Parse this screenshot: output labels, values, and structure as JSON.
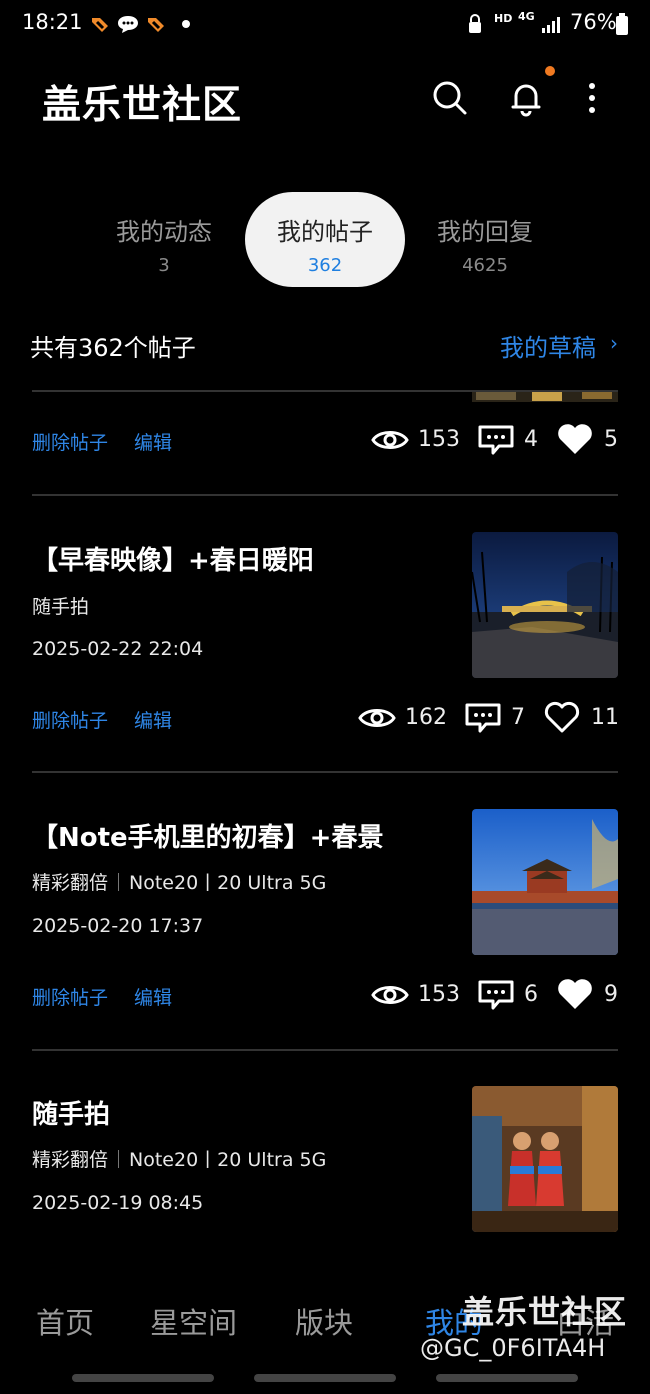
{
  "status_bar": {
    "time": "18:21",
    "hd": "HD",
    "net": "4G",
    "battery": "76%"
  },
  "header": {
    "title": "盖乐世社区"
  },
  "tabs": [
    {
      "label": "我的动态",
      "count": "3"
    },
    {
      "label": "我的帖子",
      "count": "362"
    },
    {
      "label": "我的回复",
      "count": "4625"
    }
  ],
  "summary": {
    "count_text": "共有362个帖子",
    "drafts_label": "我的草稿",
    "drafts_chevron": "›"
  },
  "actions": {
    "delete": "删除帖子",
    "edit": "编辑"
  },
  "posts": [
    {
      "views": "153",
      "comments": "4",
      "likes": "5"
    },
    {
      "title": "【早春映像】+春日暖阳",
      "category": "随手拍",
      "date": "2025-02-22 22:04",
      "views": "162",
      "comments": "7",
      "likes": "11",
      "liked": false
    },
    {
      "title": "【Note手机里的初春】+春景",
      "category": "精彩翻倍",
      "device": "Note20丨20 Ultra 5G",
      "date": "2025-02-20 17:37",
      "views": "153",
      "comments": "6",
      "likes": "9",
      "liked": true
    },
    {
      "title": "随手拍",
      "category": "精彩翻倍",
      "device": "Note20丨20 Ultra 5G",
      "date": "2025-02-19 08:45"
    }
  ],
  "bottom_nav": [
    {
      "label": "首页"
    },
    {
      "label": "星空间"
    },
    {
      "label": "版块"
    },
    {
      "label": "我的"
    },
    {
      "label": "白活"
    }
  ],
  "watermark": {
    "line1": "盖乐世社区",
    "line2": "@GC_0F6ITA4H"
  },
  "colors": {
    "accent": "#2f86e6",
    "notification": "#f07a21",
    "background": "#000000"
  }
}
